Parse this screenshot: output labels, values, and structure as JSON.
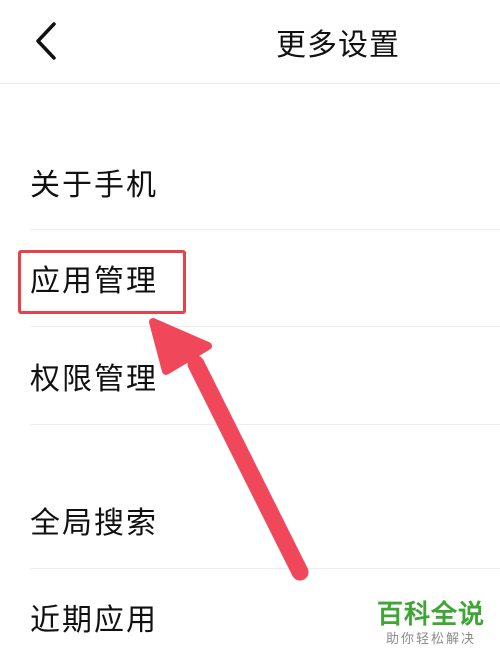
{
  "header": {
    "title": "更多设置",
    "back_icon": "chevron-left-icon"
  },
  "menu": {
    "items": [
      {
        "label": "关于手机"
      },
      {
        "label": "应用管理",
        "highlighted": true
      },
      {
        "label": "权限管理"
      },
      {
        "label": "全局搜索"
      },
      {
        "label": "近期应用"
      }
    ]
  },
  "annotation": {
    "highlight_color": "#e8414b",
    "arrow_color": "#f0475a"
  },
  "watermark": {
    "title": "百科全说",
    "subtitle": "助你轻松解决",
    "color": "#3fa535"
  }
}
